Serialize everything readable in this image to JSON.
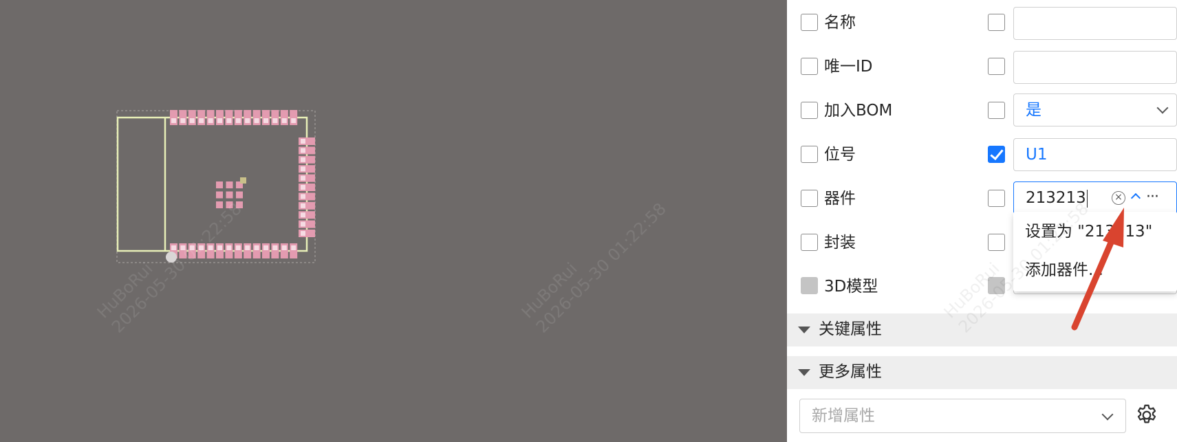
{
  "watermarks": [
    {
      "line1": "HuBoRui",
      "line2": "2026-05-30 01:22:58"
    },
    {
      "line1": "HuBoRui",
      "line2": "2026-05-30 01:22:58"
    },
    {
      "line1": "HuBoRui",
      "line2": "2026-05-30 01:22:58"
    }
  ],
  "properties": {
    "rows": [
      {
        "label": "名称",
        "left_checked": false,
        "right_checked": false,
        "value": ""
      },
      {
        "label": "唯一ID",
        "left_checked": false,
        "right_checked": false,
        "value": ""
      },
      {
        "label": "加入BOM",
        "left_checked": false,
        "right_checked": false,
        "value": "是"
      },
      {
        "label": "位号",
        "left_checked": false,
        "right_checked": true,
        "value": "U1"
      },
      {
        "label": "器件",
        "left_checked": false,
        "right_checked": false,
        "value": "213213"
      },
      {
        "label": "封装",
        "left_checked": false,
        "right_checked": false,
        "value": ""
      },
      {
        "label": "3D模型",
        "left_checked": false,
        "right_checked": false,
        "value": ""
      }
    ],
    "dropdown": {
      "options": [
        "设置为 \"213213\"",
        "添加器件..."
      ]
    },
    "sections": [
      "关键属性",
      "更多属性"
    ],
    "add_property": {
      "placeholder": "新增属性"
    }
  },
  "icons": {
    "clear": "clear-circle-icon",
    "collapse": "chevron-up-icon",
    "more": "more-dots-icon",
    "settings": "gear-icon"
  },
  "colors": {
    "canvas_bg": "#6e6a69",
    "accent": "#1677ff",
    "pad": "#e39bb0",
    "outline": "#e8efb8",
    "annotation_arrow": "#d9442f"
  }
}
